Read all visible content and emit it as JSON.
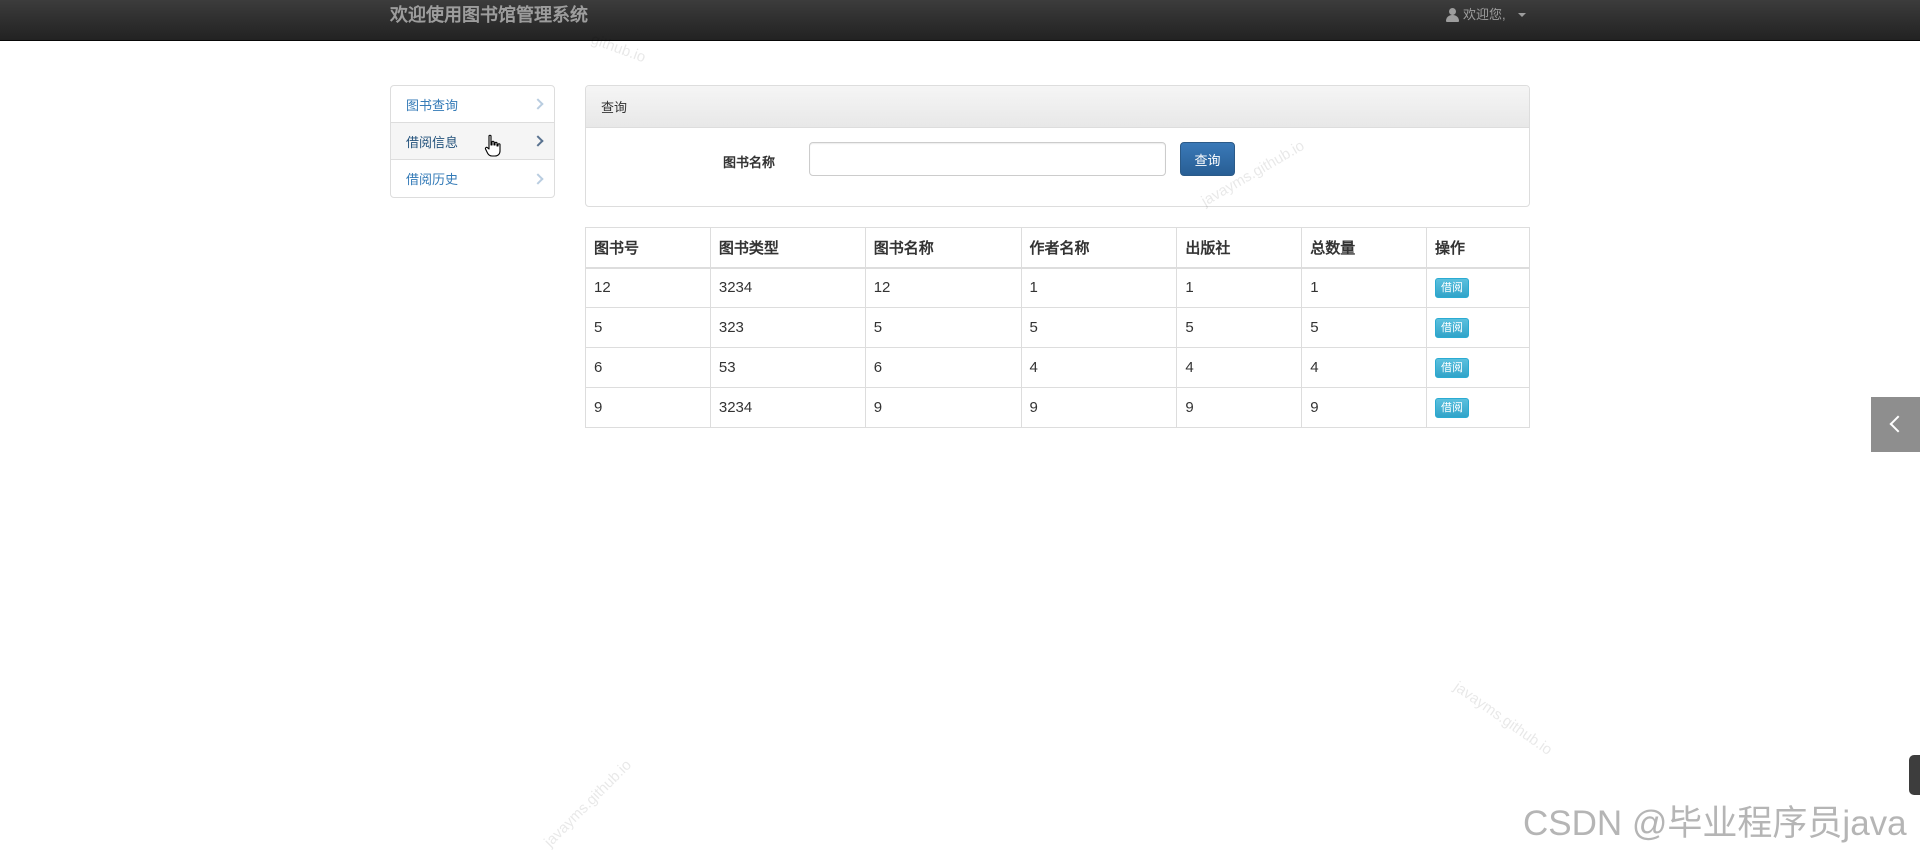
{
  "navbar": {
    "brand": "欢迎使用图书馆管理系统",
    "user_label": "欢迎您,"
  },
  "sidebar": {
    "items": [
      {
        "label": "图书查询"
      },
      {
        "label": "借阅信息"
      },
      {
        "label": "借阅历史"
      }
    ],
    "active_item": "借阅信息"
  },
  "search_panel": {
    "heading": "查询",
    "field_label": "图书名称",
    "input_value": "",
    "button_label": "查询"
  },
  "table": {
    "headers": [
      "图书号",
      "图书类型",
      "图书名称",
      "作者名称",
      "出版社",
      "总数量",
      "操作"
    ],
    "rows": [
      {
        "id": "12",
        "type": "3234",
        "name": "12",
        "author": "1",
        "publisher": "1",
        "total": "1",
        "action": "借阅"
      },
      {
        "id": "5",
        "type": "323",
        "name": "5",
        "author": "5",
        "publisher": "5",
        "total": "5",
        "action": "借阅"
      },
      {
        "id": "6",
        "type": "53",
        "name": "6",
        "author": "4",
        "publisher": "4",
        "total": "4",
        "action": "借阅"
      },
      {
        "id": "9",
        "type": "3234",
        "name": "9",
        "author": "9",
        "publisher": "9",
        "total": "9",
        "action": "借阅"
      }
    ]
  },
  "watermark": {
    "text": "javayms.github.io",
    "partial_text": "github.io"
  },
  "footer_watermark": "CSDN @毕业程序员java",
  "colors": {
    "navbar_bg": "#222222",
    "link": "#337ab7",
    "primary_button": "#286090",
    "info_button": "#5bc0de",
    "side_tab": "#8e8e8e"
  },
  "icons": {
    "user": "user-icon",
    "caret": "caret-down-icon",
    "chevron": "chevron-right-icon",
    "side_tab": "chevron-left-icon",
    "cursor": "hand-pointer-icon"
  }
}
